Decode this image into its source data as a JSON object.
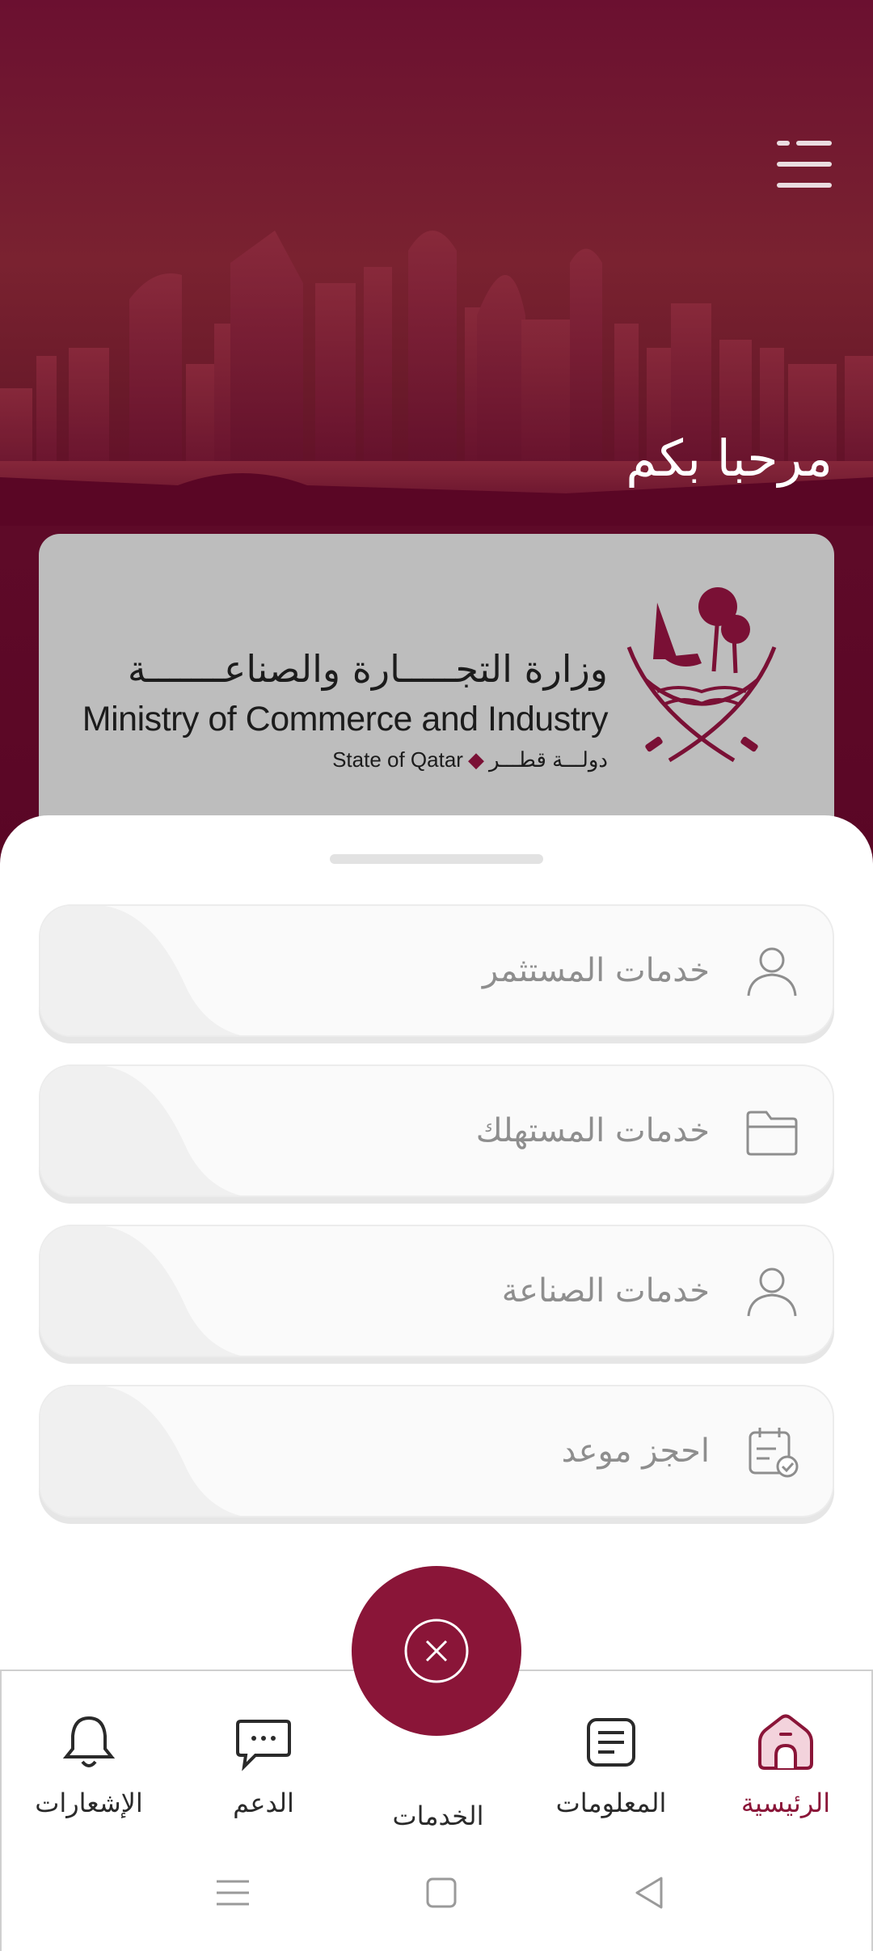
{
  "header": {
    "welcome_text": "مرحبا بكم",
    "menu_icon": "menu-icon"
  },
  "logo": {
    "arabic_name": "وزارة التجـــــارة والصناعـــــــة",
    "english_name": "Ministry of Commerce and Industry",
    "state_en": "State of Qatar",
    "state_ar": "دولـــة قطـــر",
    "emblem_icon": "qatar-emblem"
  },
  "services": [
    {
      "label": "خدمات المستثمر",
      "icon": "user-icon"
    },
    {
      "label": "خدمات المستهلك",
      "icon": "folder-icon"
    },
    {
      "label": "خدمات الصناعة",
      "icon": "user-icon"
    },
    {
      "label": "احجز موعد",
      "icon": "calendar-check-icon"
    }
  ],
  "fab": {
    "icon": "close-circle-icon"
  },
  "bottom_nav": {
    "items": [
      {
        "label": "الرئيسية",
        "icon": "home-icon",
        "active": true
      },
      {
        "label": "المعلومات",
        "icon": "news-icon",
        "active": false
      },
      {
        "label": "الخدمات",
        "icon": "services-icon",
        "active": false
      },
      {
        "label": "الدعم",
        "icon": "chat-icon",
        "active": false
      },
      {
        "label": "الإشعارات",
        "icon": "bell-icon",
        "active": false
      }
    ]
  },
  "system_nav": [
    "recents-icon",
    "home-square-icon",
    "back-triangle-icon"
  ],
  "colors": {
    "brand": "#8a1538",
    "hero_bg": "#5e0a28",
    "card_bg": "#bdbdbd",
    "label_gray": "#8e8e8e"
  }
}
